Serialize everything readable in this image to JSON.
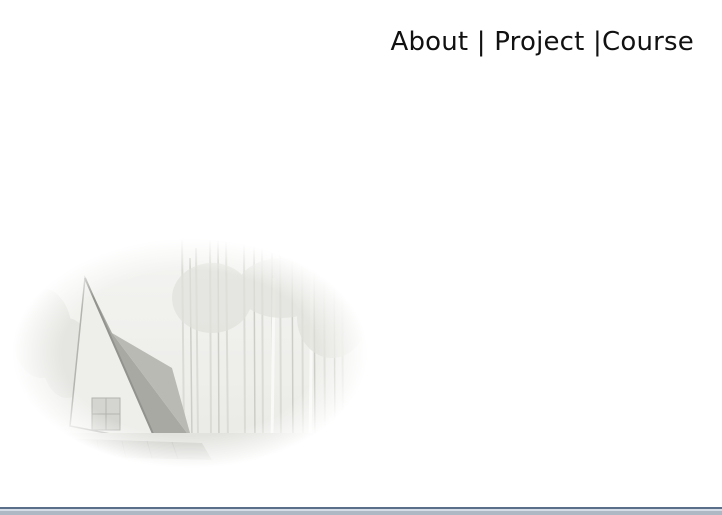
{
  "nav": {
    "about_label": "About",
    "sep1": " | ",
    "project_label": "Project",
    "sep2": " |",
    "course_label": "Course"
  },
  "colors": {
    "text": "#111111",
    "background": "#ffffff",
    "bottom_rule": "#5a6f8a"
  },
  "hero": {
    "icon": "a-frame-cabin-forest-image"
  }
}
